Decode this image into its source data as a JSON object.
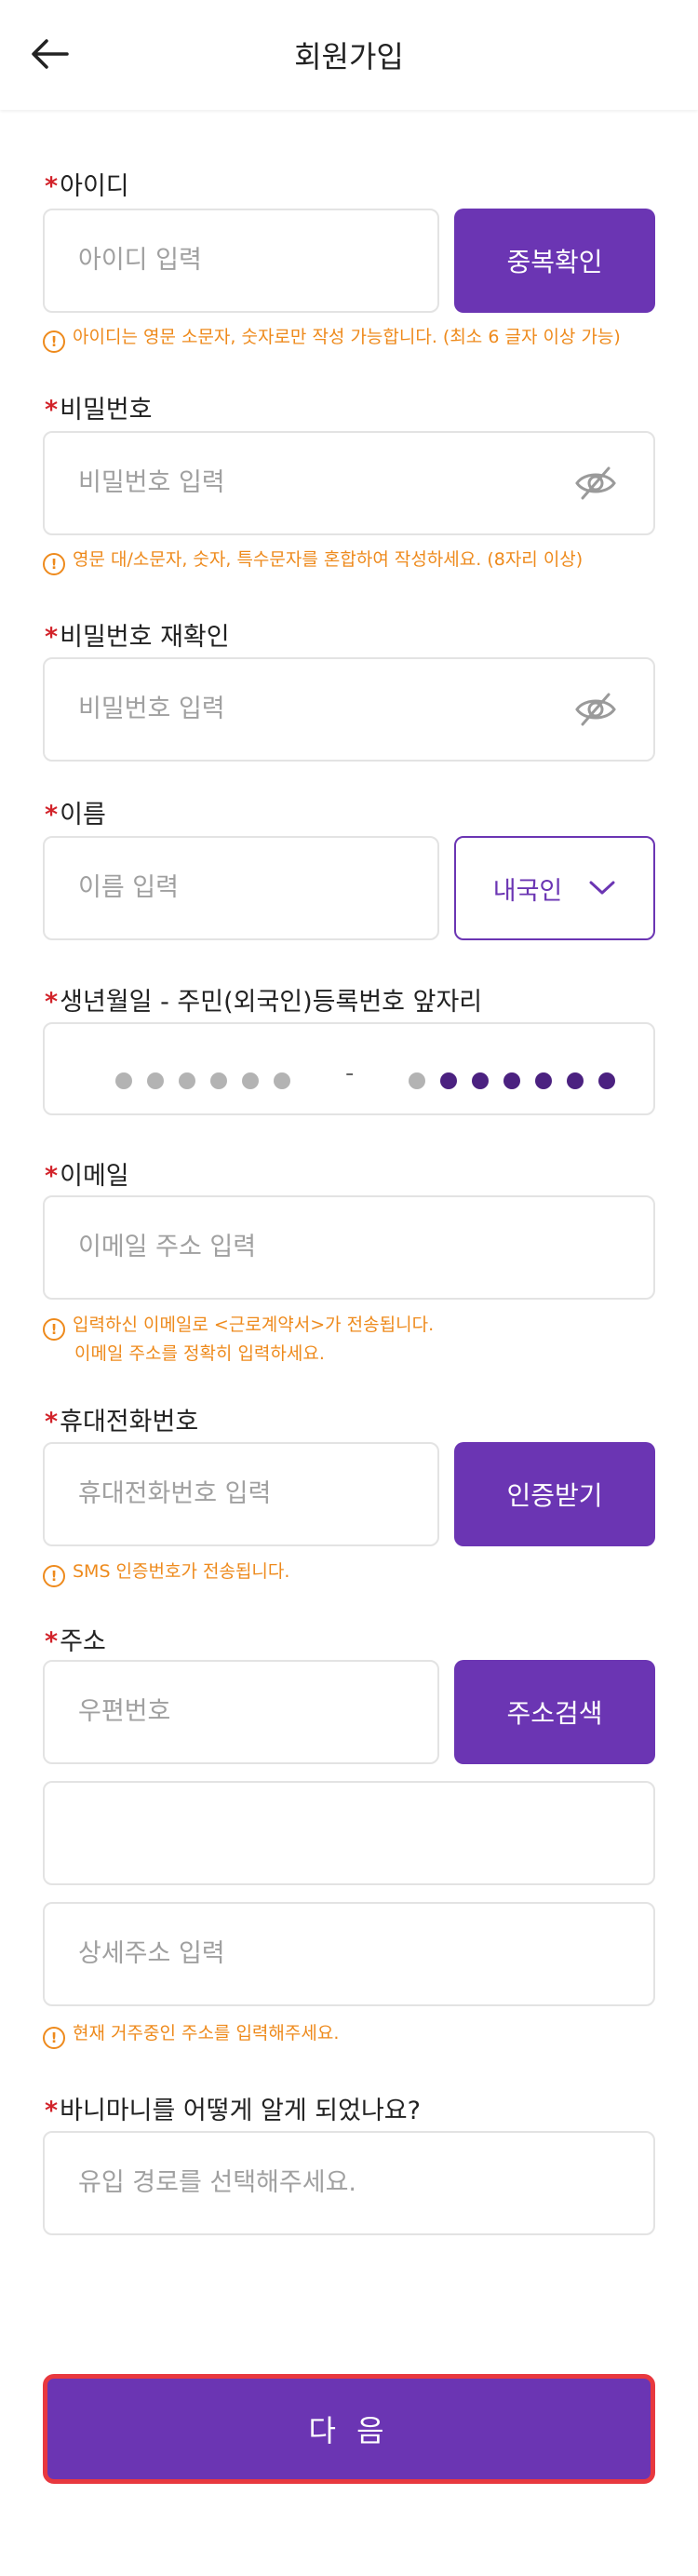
{
  "header": {
    "title": "회원가입"
  },
  "id": {
    "label": "아이디",
    "placeholder": "아이디 입력",
    "button": "중복확인",
    "hint": "아이디는 영문 소문자, 숫자로만 작성 가능합니다. (최소 6 글자 이상 가능)"
  },
  "password": {
    "label": "비밀번호",
    "placeholder": "비밀번호 입력",
    "hint": "영문 대/소문자, 숫자, 특수문자를 혼합하여 작성하세요. (8자리 이상)"
  },
  "password_confirm": {
    "label": "비밀번호 재확인",
    "placeholder": "비밀번호 입력"
  },
  "name": {
    "label": "이름",
    "placeholder": "이름 입력",
    "nationality": "내국인"
  },
  "birth": {
    "label": "생년월일 - 주민(외국인)등록번호 앞자리",
    "separator": "-"
  },
  "email": {
    "label": "이메일",
    "placeholder": "이메일 주소 입력",
    "hint_line1": "입력하신 이메일로 <근로계약서>가 전송됩니다.",
    "hint_line2": "이메일 주소를 정확히 입력하세요."
  },
  "phone": {
    "label": "휴대전화번호",
    "placeholder": "휴대전화번호 입력",
    "button": "인증받기",
    "hint": "SMS 인증번호가 전송됩니다."
  },
  "address": {
    "label": "주소",
    "zip_placeholder": "우편번호",
    "button": "주소검색",
    "detail_placeholder": "상세주소 입력",
    "hint": "현재 거주중인 주소를 입력해주세요."
  },
  "referral": {
    "label": "바니마니를 어떻게 알게 되었나요?",
    "placeholder": "유입 경로를 선택해주세요."
  },
  "next_button": "다 음",
  "required_mark": "*",
  "hint_icon": "!",
  "colors": {
    "accent": "#6b35b3",
    "required": "#d2232a",
    "hint": "#ee8a1c",
    "highlight_border": "#e8383f"
  },
  "icons": {
    "back": "arrow-left-icon",
    "eye": "eye-off-icon",
    "dropdown": "chevron-down-icon",
    "hint": "exclamation-circle-icon"
  }
}
